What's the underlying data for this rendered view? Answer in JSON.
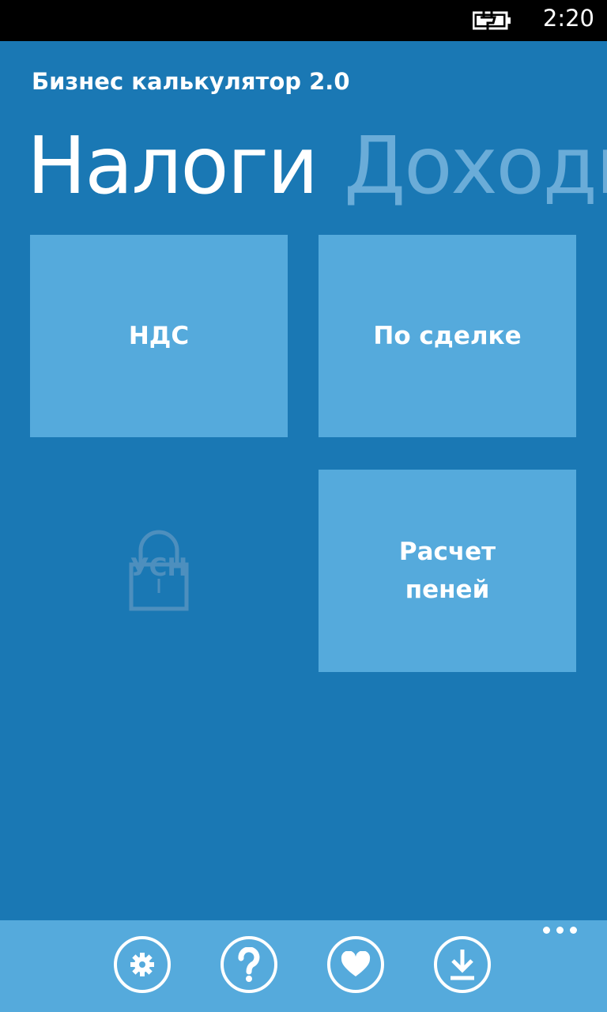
{
  "status_bar": {
    "time": "2:20",
    "battery_icon": "battery-charging-icon"
  },
  "app": {
    "title": "Бизнес калькулятор 2.0"
  },
  "pivot": {
    "active": "Налоги",
    "next": "Доходы"
  },
  "tiles": [
    {
      "label": "НДС"
    },
    {
      "label": "По сделке"
    },
    {
      "label_line1": "Расчет",
      "label_line2": "пеней"
    }
  ],
  "locked_tile": {
    "label": "УСН",
    "icon": "lock-icon"
  },
  "app_bar": {
    "buttons": [
      "settings-icon",
      "help-icon",
      "heart-icon",
      "download-icon"
    ],
    "more": "more-icon"
  },
  "colors": {
    "background": "#1a78b4",
    "tile": "#55aadc",
    "inactive_pivot": "#6aacd8",
    "status_bar": "#000000"
  }
}
